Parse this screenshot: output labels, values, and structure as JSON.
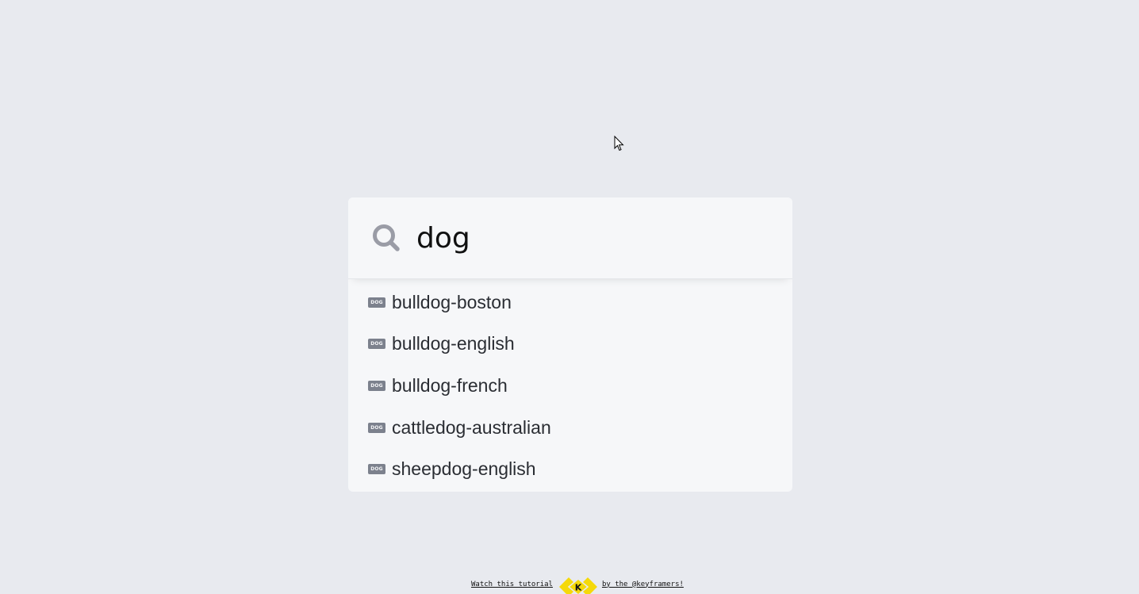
{
  "search": {
    "value": "dog",
    "icon": "search-icon"
  },
  "results": [
    {
      "badge": "DOG",
      "label": "bulldog-boston"
    },
    {
      "badge": "DOG",
      "label": "bulldog-english"
    },
    {
      "badge": "DOG",
      "label": "bulldog-french"
    },
    {
      "badge": "DOG",
      "label": "cattledog-australian"
    },
    {
      "badge": "DOG",
      "label": "sheepdog-english"
    }
  ],
  "footer": {
    "tutorial_link": "Watch this tutorial",
    "logo_letter": "K",
    "credit_link": "by the @keyframers!"
  },
  "colors": {
    "background": "#e8eaef",
    "panel": "#f6f7f9",
    "icon_gray": "#9a9ca6",
    "logo_yellow": "#f5d90a"
  }
}
